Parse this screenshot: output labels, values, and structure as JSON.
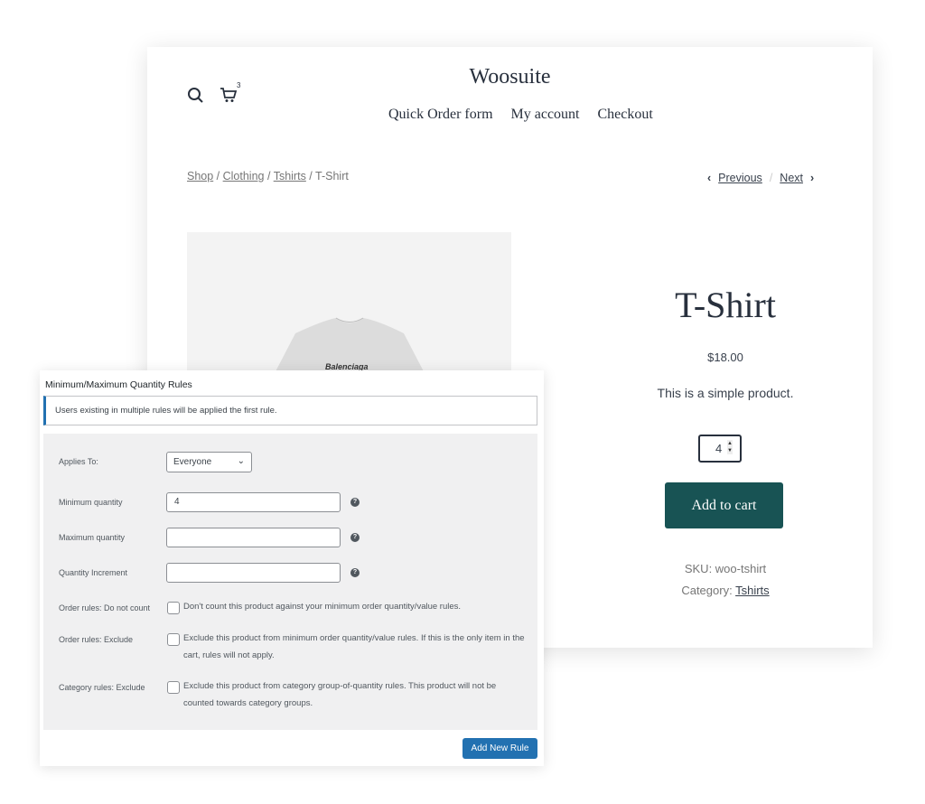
{
  "store": {
    "brand": "Woosuite",
    "cart_count": "3",
    "nav": [
      "Quick Order form",
      "My account",
      "Checkout"
    ],
    "breadcrumb": [
      "Shop",
      "Clothing",
      "Tshirts",
      "T-Shirt"
    ],
    "prev": "Previous",
    "next": "Next",
    "image_logo": "Balenciaga",
    "product": {
      "title": "T-Shirt",
      "price": "$18.00",
      "description": "This is a simple product.",
      "quantity": "4",
      "add_to_cart": "Add to cart",
      "sku": "SKU: woo-tshirt",
      "category_label": "Category:",
      "category": "Tshirts"
    },
    "accent": "#185354"
  },
  "admin": {
    "title": "Minimum/Maximum Quantity Rules",
    "notice": "Users existing in multiple rules will be applied the first rule.",
    "applies_to_label": "Applies To:",
    "applies_to_value": "Everyone",
    "min_label": "Minimum quantity",
    "min_value": "4",
    "max_label": "Maximum quantity",
    "max_value": "",
    "inc_label": "Quantity Increment",
    "inc_value": "",
    "rules": [
      {
        "label": "Order rules: Do not count",
        "text": "Don't count this product against your minimum order quantity/value rules.",
        "checked": false
      },
      {
        "label": "Order rules: Exclude",
        "text": "Exclude this product from minimum order quantity/value rules. If this is the only item in the cart, rules will not apply.",
        "checked": false
      },
      {
        "label": "Category rules: Exclude",
        "text": "Exclude this product from category group-of-quantity rules. This product will not be counted towards category groups.",
        "checked": false
      }
    ],
    "add_rule": "Add New Rule",
    "accent": "#2271b1"
  }
}
